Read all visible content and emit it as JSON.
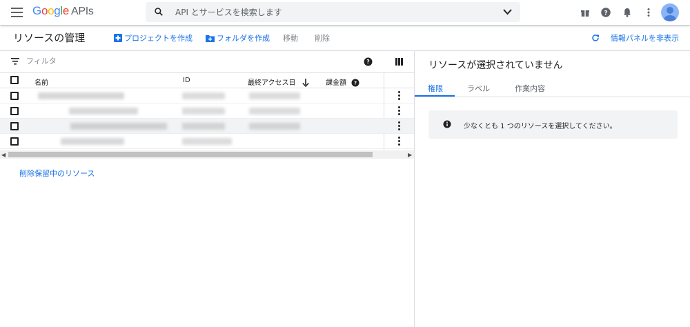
{
  "header": {
    "logo_google": [
      "G",
      "o",
      "o",
      "g",
      "l",
      "e"
    ],
    "logo_product": "APIs",
    "search_placeholder": "API とサービスを検索します"
  },
  "actionbar": {
    "title": "リソースの管理",
    "create_project": "プロジェクトを作成",
    "create_folder": "フォルダを作成",
    "move": "移動",
    "delete": "削除",
    "toggle_info_panel": "情報パネルを非表示"
  },
  "filter": {
    "placeholder": "フィルタ"
  },
  "table": {
    "columns": {
      "name": "名前",
      "id": "ID",
      "last_access": "最終アクセス日",
      "charges": "課金額"
    },
    "row_count": 4
  },
  "pending_deletion_link": "削除保留中のリソース",
  "info_panel": {
    "title": "リソースが選択されていません",
    "tabs": [
      "権限",
      "ラベル",
      "作業内容"
    ],
    "active_tab": 0,
    "notice": "少なくとも 1 つのリソースを選択してください。"
  },
  "colors": {
    "accent": "#1a73e8",
    "text": "#202124",
    "muted": "#5f6368"
  }
}
